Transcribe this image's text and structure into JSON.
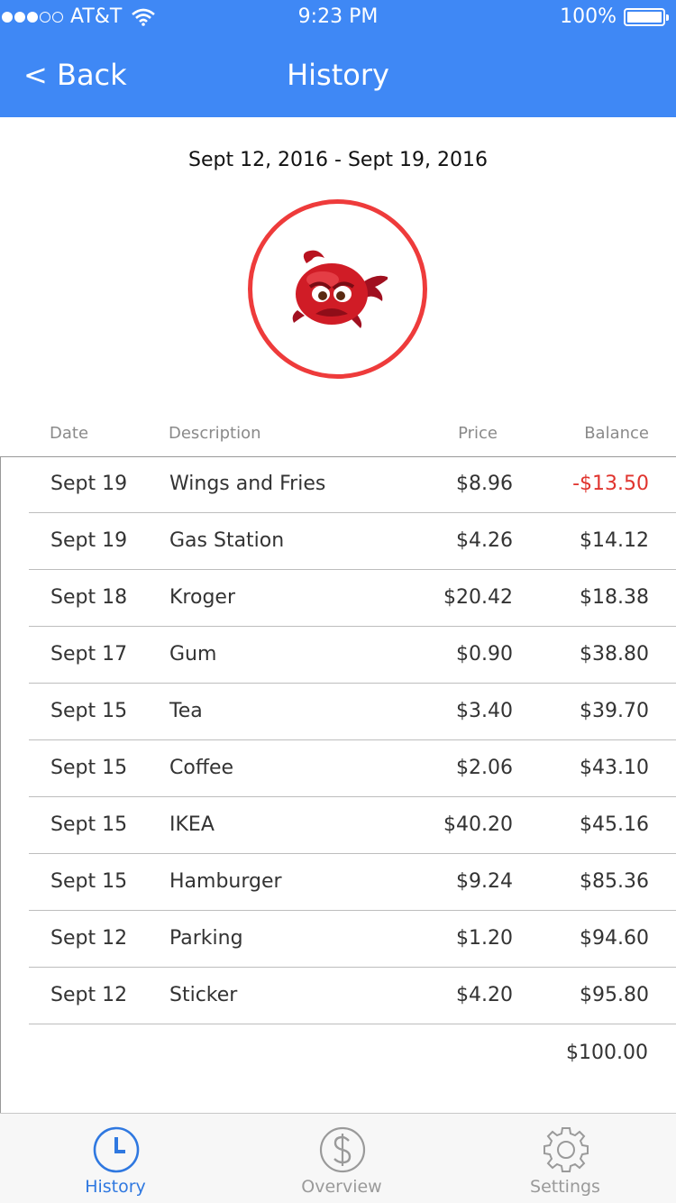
{
  "status_bar": {
    "carrier": "AT&T",
    "time": "9:23 PM",
    "battery": "100%",
    "signal_bars": 3,
    "signal_total": 5
  },
  "nav": {
    "back_label": "< Back",
    "title": "History"
  },
  "date_range": "Sept 12, 2016 - Sept 19, 2016",
  "avatar": {
    "icon": "sad-red-bird-icon",
    "ring_color": "#ee3b3b"
  },
  "columns": {
    "date": "Date",
    "description": "Description",
    "price": "Price",
    "balance": "Balance"
  },
  "transactions": [
    {
      "date": "Sept 19",
      "description": "Wings and Fries",
      "price": "$8.96",
      "balance": "-$13.50"
    },
    {
      "date": "Sept 19",
      "description": "Gas Station",
      "price": "$4.26",
      "balance": "$14.12"
    },
    {
      "date": "Sept 18",
      "description": "Kroger",
      "price": "$20.42",
      "balance": "$18.38"
    },
    {
      "date": "Sept 17",
      "description": "Gum",
      "price": "$0.90",
      "balance": "$38.80"
    },
    {
      "date": "Sept 15",
      "description": "Tea",
      "price": "$3.40",
      "balance": "$39.70"
    },
    {
      "date": "Sept 15",
      "description": "Coffee",
      "price": "$2.06",
      "balance": "$43.10"
    },
    {
      "date": "Sept 15",
      "description": "IKEA",
      "price": "$40.20",
      "balance": "$45.16"
    },
    {
      "date": "Sept 15",
      "description": "Hamburger",
      "price": "$9.24",
      "balance": "$85.36"
    },
    {
      "date": "Sept 12",
      "description": "Parking",
      "price": "$1.20",
      "balance": "$94.60"
    },
    {
      "date": "Sept 12",
      "description": "Sticker",
      "price": "$4.20",
      "balance": "$95.80"
    }
  ],
  "starting_balance": "$100.00",
  "tabs": [
    {
      "label": "History",
      "icon": "clock-icon",
      "active": true
    },
    {
      "label": "Overview",
      "icon": "dollar-icon",
      "active": false
    },
    {
      "label": "Settings",
      "icon": "gear-icon",
      "active": false
    }
  ],
  "colors": {
    "accent": "#3f88f5",
    "negative": "#e0342e",
    "tab_active": "#2f78e0",
    "tab_inactive": "#9a9a9a"
  }
}
